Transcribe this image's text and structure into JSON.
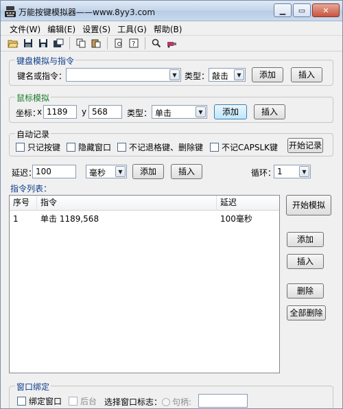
{
  "window": {
    "title": "万能按键模拟器——www.8yy3.com",
    "controls": {
      "minimize": "▁",
      "restore": "▭",
      "close": "✕"
    }
  },
  "menu": [
    "文件(W)",
    "编辑(E)",
    "设置(S)",
    "工具(G)",
    "帮助(B)"
  ],
  "toolbar_icons": [
    "open-folder-icon",
    "save-icon",
    "save-as-icon",
    "properties-icon",
    "copy-icon",
    "paste-icon",
    "print-preview-icon",
    "help-icon",
    "magnifier-icon",
    "usb-device-icon"
  ],
  "keyboard": {
    "group_title": "键盘模拟与指令",
    "key_label": "键名或指令：",
    "key_value": "",
    "type_label": "类型：",
    "type_value": "敲击",
    "add": "添加",
    "insert": "插入"
  },
  "mouse": {
    "group_title": "鼠标模拟",
    "coord_label": "坐标：",
    "x_label": "x",
    "x_value": "1189",
    "y_label": "y",
    "y_value": "568",
    "type_label": "类型：",
    "type_value": "单击",
    "add": "添加",
    "insert": "插入"
  },
  "autorecord": {
    "group_title": "自动记录",
    "only_keys": "只记按键",
    "hide_window": "隐藏窗口",
    "no_backspace_delete": "不记退格键、删除键",
    "no_capslk": "不记CAPSLK键",
    "start": "开始记录"
  },
  "delay": {
    "label": "延迟：",
    "value": "100",
    "unit": "毫秒",
    "add": "添加",
    "insert": "插入",
    "loop_label": "循环：",
    "loop_value": "1"
  },
  "list": {
    "title": "指令列表：",
    "columns": [
      "序号",
      "指令",
      "延迟"
    ],
    "rows": [
      {
        "index": "1",
        "command": "单击 1189,568",
        "delay": "100毫秒"
      }
    ]
  },
  "side_buttons": {
    "start_sim": "开始模拟",
    "add": "添加",
    "insert": "插入",
    "delete": "删除",
    "delete_all": "全部删除"
  },
  "bind": {
    "group_title": "窗口绑定",
    "bind_window": "绑定窗口",
    "background": "后台",
    "select_label": "选择窗口标志：",
    "handle_label": "句柄:",
    "handle_value": ""
  }
}
